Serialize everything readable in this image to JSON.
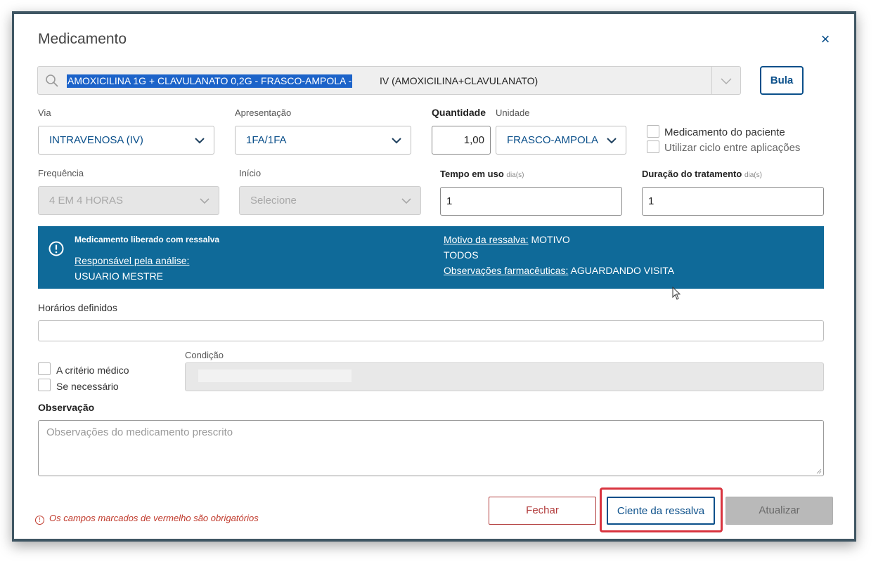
{
  "dialog": {
    "title": "Medicamento",
    "close_label": "×"
  },
  "search": {
    "selected_text": "AMOXICILINA 1G + CLAVULANATO 0,2G - FRASCO-AMPOLA -",
    "rest_text": "IV (AMOXICILINA+CLAVULANATO)",
    "bula_label": "Bula"
  },
  "fields": {
    "via_label": "Via",
    "via_value": "INTRAVENOSA (IV)",
    "apresentacao_label": "Apresentação",
    "apresentacao_value": "1FA/1FA",
    "quantidade_label": "Quantidade",
    "quantidade_value": "1,00",
    "unidade_label": "Unidade",
    "unidade_value": "FRASCO-AMPOLA",
    "med_paciente_label": "Medicamento do paciente",
    "ciclo_label": "Utilizar ciclo entre aplicações",
    "frequencia_label": "Frequência",
    "frequencia_value": "4 EM 4 HORAS",
    "inicio_label": "Início",
    "inicio_value": "Selecione",
    "tempo_label": "Tempo em uso",
    "tempo_unit": "dia(s)",
    "tempo_value": "1",
    "duracao_label": "Duração do tratamento",
    "duracao_unit": "dia(s)",
    "duracao_value": "1"
  },
  "banner": {
    "title": "Medicamento liberado com ressalva",
    "responsavel_label": "Responsável pela análise:",
    "responsavel_value": "USUARIO MESTRE",
    "motivo_label": "Motivo da ressalva:",
    "motivo_value": "MOTIVO",
    "todos": "TODOS",
    "obs_label": "Observações farmacêuticas:",
    "obs_value": "AGUARDANDO VISITA",
    "color": "#0f6a99"
  },
  "horarios": {
    "label": "Horários definidos"
  },
  "options": {
    "criterio_label": "A critério médico",
    "necessario_label": "Se necessário",
    "condicao_label": "Condição"
  },
  "observacao": {
    "label": "Observação",
    "placeholder": "Observações do medicamento prescrito"
  },
  "footer": {
    "required_note": "Os campos marcados de vermelho são obrigatórios",
    "fechar_label": "Fechar",
    "ciente_label": "Ciente da ressalva",
    "atualizar_label": "Atualizar"
  }
}
